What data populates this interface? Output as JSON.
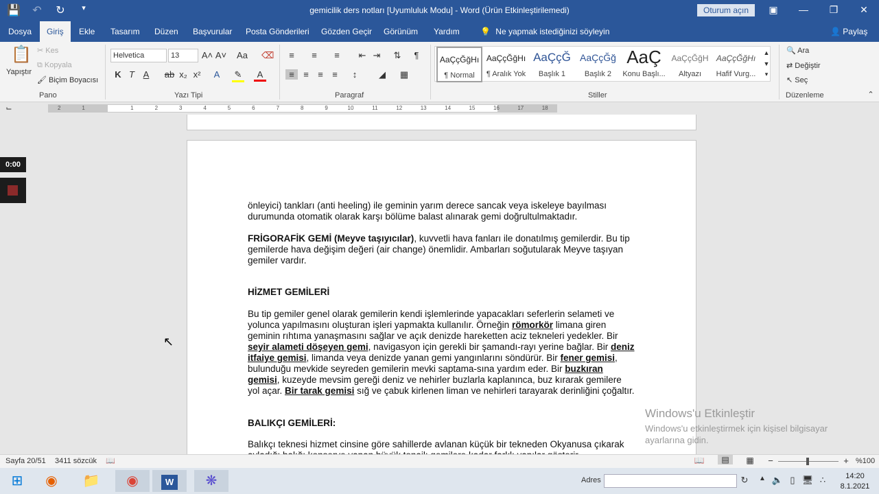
{
  "window": {
    "title": "gemicilik ders notları [Uyumluluk Modu]  -  Word (Ürün Etkinleştirilemedi)",
    "signin_label": "Oturum açın",
    "share_label": "Paylaş"
  },
  "tabs": [
    "Dosya",
    "Giriş",
    "Ekle",
    "Tasarım",
    "Düzen",
    "Başvurular",
    "Posta Gönderileri",
    "Gözden Geçir",
    "Görünüm",
    "Yardım"
  ],
  "tell_me": "Ne yapmak istediğinizi söyleyin",
  "ribbon": {
    "pano": {
      "paste": "Yapıştır",
      "cut": "Kes",
      "copy": "Kopyala",
      "format_painter": "Biçim Boyacısı",
      "label": "Pano"
    },
    "font": {
      "family": "Helvetica",
      "size": "13",
      "label": "Yazı Tipi"
    },
    "paragraph": {
      "label": "Paragraf"
    },
    "styles": {
      "label": "Stiller",
      "items": [
        {
          "preview": "AaÇçĞğHı",
          "name": "¶ Normal"
        },
        {
          "preview": "AaÇçĞğHı",
          "name": "¶ Aralık Yok"
        },
        {
          "preview": "AaÇçĞ",
          "name": "Başlık 1"
        },
        {
          "preview": "AaÇçĞğ",
          "name": "Başlık 2"
        },
        {
          "preview": "AaÇ",
          "name": "Konu Başlı..."
        },
        {
          "preview": "AaÇçĞğH",
          "name": "Altyazı"
        },
        {
          "preview": "AaÇçĞğHı",
          "name": "Hafif Vurg..."
        }
      ]
    },
    "editing": {
      "find": "Ara",
      "replace": "Değiştir",
      "select": "Seç",
      "label": "Düzenleme"
    }
  },
  "ruler": {
    "labels": [
      "2",
      "1",
      "1",
      "2",
      "3",
      "4",
      "5",
      "6",
      "7",
      "8",
      "9",
      "10",
      "11",
      "12",
      "13",
      "14",
      "15",
      "16",
      "17",
      "18"
    ]
  },
  "recorder": {
    "time": "0:00"
  },
  "document": {
    "p1": "önleyici) tankları (anti heeling) ile geminin yarım derece sancak veya iskeleye bayılması durumunda otomatik olarak karşı bölüme balast alınarak gemi doğrultulmaktadır.",
    "p2_bold": "FRİGORAFİK GEMİ (Meyve taşıyıcılar)",
    "p2_rest": ", kuvvetli hava fanları ile donatılmış gemilerdir. Bu tip gemilerde hava değişim değeri (air change) önemlidir. Ambarları soğutularak Meyve taşıyan gemiler vardır.",
    "h1": "HİZMET GEMİLERİ",
    "p3": {
      "a": "Bu tip gemiler genel olarak gemilerin kendi işlemlerinde yapacakları seferlerin selameti ve yolunca yapılmasını oluşturan işleri yapmakta kullanılır. Örneğin ",
      "b": "römorkör",
      "c": " limana giren geminin rıhtıma yanaşmasını sağlar ve açık denizde hareketten aciz tekneleri yedekler. Bir ",
      "d": "seyir alameti döşeyen gemi",
      "e": ", navigasyon için gerekli bir şamandı-rayı yerine bağlar. Bir ",
      "f": "deniz itfaiye gemisi",
      "g": ", limanda veya denizde yanan gemi yangınlarını söndürür. Bir ",
      "h": "fener gemisi",
      "i": ", bulunduğu mevkide seyreden gemilerin mevki saptama-sına yardım eder. Bir ",
      "j": "buzkıran gemisi",
      "k": ", kuzeyde mevsim gereği deniz ve nehirler buzlarla kaplanınca, buz kırarak gemilere yol açar. ",
      "l": "Bir tarak gemisi",
      "m": " sığ ve çabuk kirlenen liman ve nehirleri tarayarak derinliğini çoğaltır."
    },
    "h2": "BALIKÇI GEMİLERİ:",
    "p4": "Balıkçı teknesi hizmet cinsine göre sahillerde avlanan küçük bir tekneden Okyanusa çıkarak avladığı balığı konserve yapan büyük tonajlı gemilere kadar farklı yapılar gösterir."
  },
  "watermark": {
    "line1": "Windows'u Etkinleştir",
    "line2": "Windows'u etkinleştirmek için kişisel bilgisayar",
    "line3": "ayarlarına gidin."
  },
  "status": {
    "page": "Sayfa 20/51",
    "words": "3411 sözcük",
    "zoom": "%100"
  },
  "taskbar": {
    "address_label": "Adres",
    "time": "14:20",
    "date": "8.1.2021"
  }
}
